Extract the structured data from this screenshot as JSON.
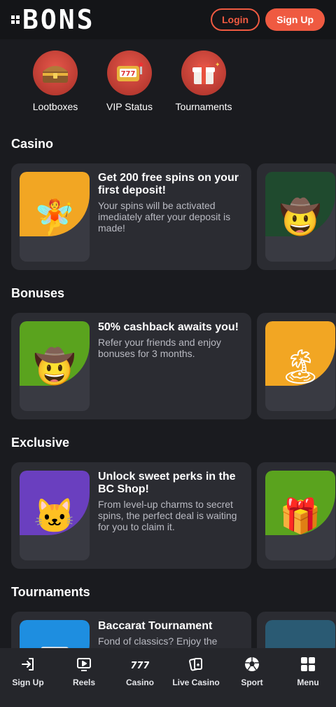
{
  "header": {
    "logo_text": "BONS",
    "login_label": "Login",
    "signup_label": "Sign Up",
    "accent_color": "#ef5a41"
  },
  "quick_links": [
    {
      "label": "Lootboxes",
      "icon": "treasure-chest-icon"
    },
    {
      "label": "VIP Status",
      "icon": "slot-machine-icon"
    },
    {
      "label": "Tournaments",
      "icon": "gift-box-icon"
    }
  ],
  "sections": {
    "casino": {
      "title": "Casino",
      "card": {
        "title": "Get 200 free spins on your first deposit!",
        "desc": "Your spins will be activated imediately after your deposit is made!"
      }
    },
    "bonuses": {
      "title": "Bonuses",
      "card": {
        "title": "50% cashback awaits you!",
        "desc": "Refer your friends and enjoy bonuses for 3 months."
      }
    },
    "exclusive": {
      "title": "Exclusive",
      "card": {
        "title": "Unlock sweet perks in the BC Shop!",
        "desc": "From level-up charms to secret spins, the perfect deal is waiting for you to claim it."
      }
    },
    "tournaments": {
      "title": "Tournaments",
      "card": {
        "title": "Baccarat Tournament",
        "desc": "Fond of classics? Enjoy the"
      }
    }
  },
  "bottom_nav": [
    {
      "label": "Sign Up",
      "icon": "sign-in-icon"
    },
    {
      "label": "Reels",
      "icon": "reels-icon"
    },
    {
      "label": "Casino",
      "icon": "casino-777-icon"
    },
    {
      "label": "Live Casino",
      "icon": "playing-cards-icon"
    },
    {
      "label": "Sport",
      "icon": "soccer-ball-icon"
    },
    {
      "label": "Menu",
      "icon": "grid-menu-icon"
    }
  ]
}
